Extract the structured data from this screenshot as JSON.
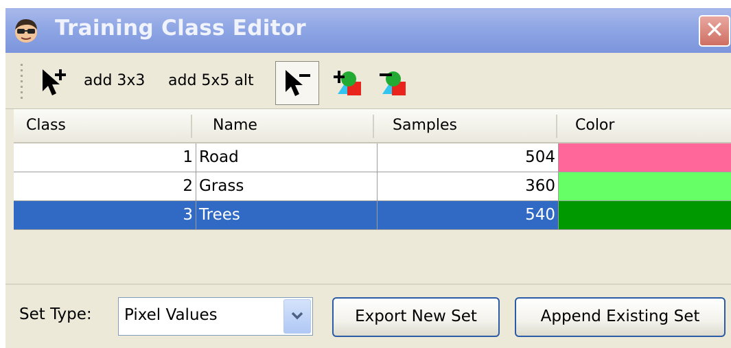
{
  "window": {
    "title": "Training Class Editor",
    "close_symbol": "✕"
  },
  "toolbar": {
    "tools": [
      {
        "icon": "add-point-cursor-icon",
        "label": ""
      },
      {
        "label": "add 3x3"
      },
      {
        "label": "add 5x5 alt"
      },
      {
        "icon": "remove-point-cursor-icon",
        "pressed": true
      },
      {
        "icon": "add-class-icon"
      },
      {
        "icon": "remove-class-icon"
      }
    ],
    "add3x3_label": "add 3x3",
    "add5x5_label": "add 5x5 alt"
  },
  "table": {
    "columns": [
      "Class",
      "Name",
      "Samples",
      "Color"
    ],
    "rows": [
      {
        "class": "1",
        "name": "Road",
        "samples": "504",
        "color": "#ff6699",
        "selected": false
      },
      {
        "class": "2",
        "name": "Grass",
        "samples": "360",
        "color": "#66ff66",
        "selected": false
      },
      {
        "class": "3",
        "name": "Trees",
        "samples": "540",
        "color": "#009900",
        "selected": true
      }
    ]
  },
  "footer": {
    "set_type_label": "Set Type:",
    "set_type_value": "Pixel Values",
    "export_label": "Export New Set",
    "append_label": "Append Existing Set"
  },
  "colors": {
    "title_bar": "#8ea6e4",
    "selection": "#316ac5",
    "panel_bg": "#ece9d8"
  }
}
